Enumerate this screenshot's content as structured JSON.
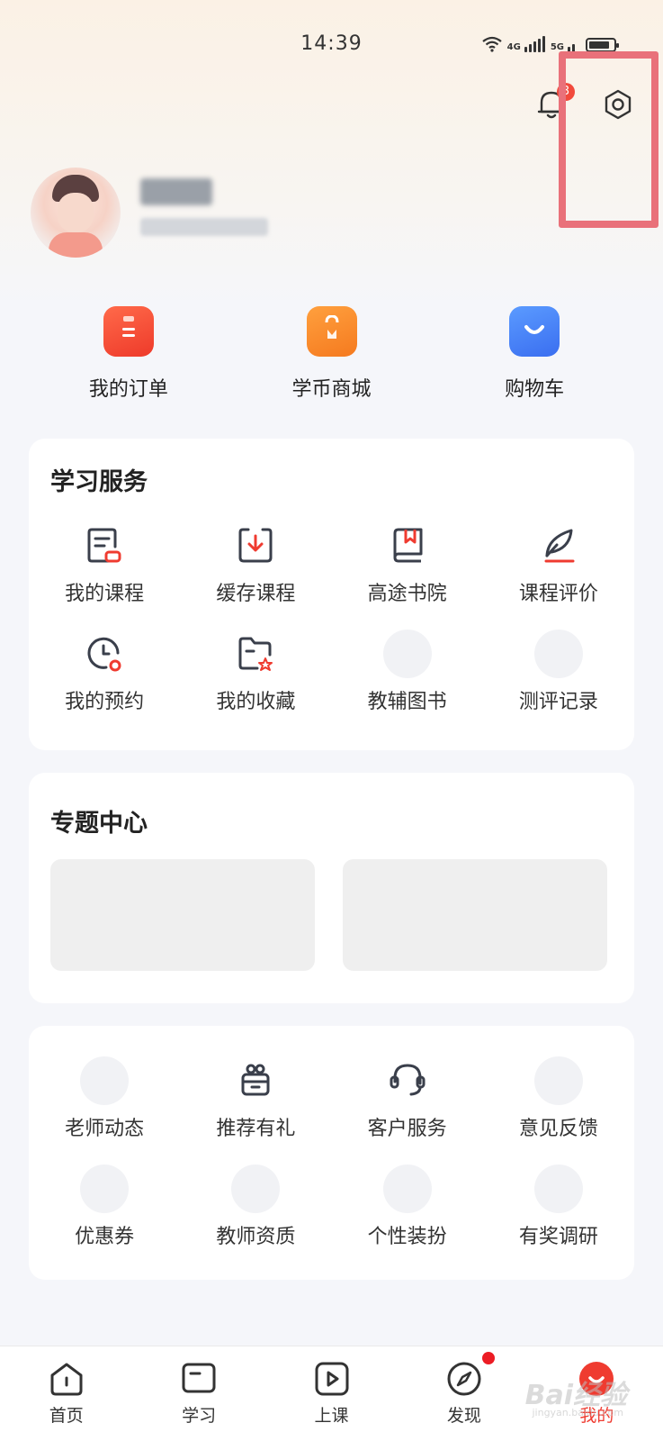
{
  "status_bar": {
    "time": "14:39",
    "network_left": "4G",
    "network_right": "5G"
  },
  "header": {
    "notification_count": "3"
  },
  "quick_links": [
    {
      "label": "我的订单",
      "icon": "clipboard-icon",
      "color": "#f2492e"
    },
    {
      "label": "学币商城",
      "icon": "shopping-bag-icon",
      "color": "#f7862a"
    },
    {
      "label": "购物车",
      "icon": "cart-icon",
      "color": "#3f7ef2"
    }
  ],
  "study_services": {
    "title": "学习服务",
    "items": [
      {
        "label": "我的课程",
        "icon": "course-doc-icon"
      },
      {
        "label": "缓存课程",
        "icon": "download-icon"
      },
      {
        "label": "高途书院",
        "icon": "book-icon"
      },
      {
        "label": "课程评价",
        "icon": "feather-pen-icon"
      },
      {
        "label": "我的预约",
        "icon": "clock-icon"
      },
      {
        "label": "我的收藏",
        "icon": "folder-star-icon"
      },
      {
        "label": "教辅图书",
        "icon": "placeholder-icon"
      },
      {
        "label": "测评记录",
        "icon": "placeholder-icon"
      }
    ]
  },
  "topic_center": {
    "title": "专题中心"
  },
  "more_services": {
    "items": [
      {
        "label": "老师动态",
        "icon": "placeholder-icon"
      },
      {
        "label": "推荐有礼",
        "icon": "gift-icon"
      },
      {
        "label": "客户服务",
        "icon": "headset-icon"
      },
      {
        "label": "意见反馈",
        "icon": "placeholder-icon"
      },
      {
        "label": "优惠券",
        "icon": "placeholder-icon"
      },
      {
        "label": "教师资质",
        "icon": "placeholder-icon"
      },
      {
        "label": "个性装扮",
        "icon": "placeholder-icon"
      },
      {
        "label": "有奖调研",
        "icon": "placeholder-icon"
      }
    ]
  },
  "tabbar": {
    "tabs": [
      {
        "label": "首页",
        "icon": "home-icon"
      },
      {
        "label": "学习",
        "icon": "study-icon"
      },
      {
        "label": "上课",
        "icon": "play-icon"
      },
      {
        "label": "发现",
        "icon": "compass-icon"
      },
      {
        "label": "我的",
        "icon": "profile-icon"
      }
    ],
    "active": "我的"
  },
  "watermark": {
    "text": "Bai经验",
    "sub": "jingyan.baidu.com"
  },
  "colors": {
    "accent": "#ef3b30",
    "icon_stroke": "#3a3f4b",
    "highlight": "#e9717a"
  }
}
